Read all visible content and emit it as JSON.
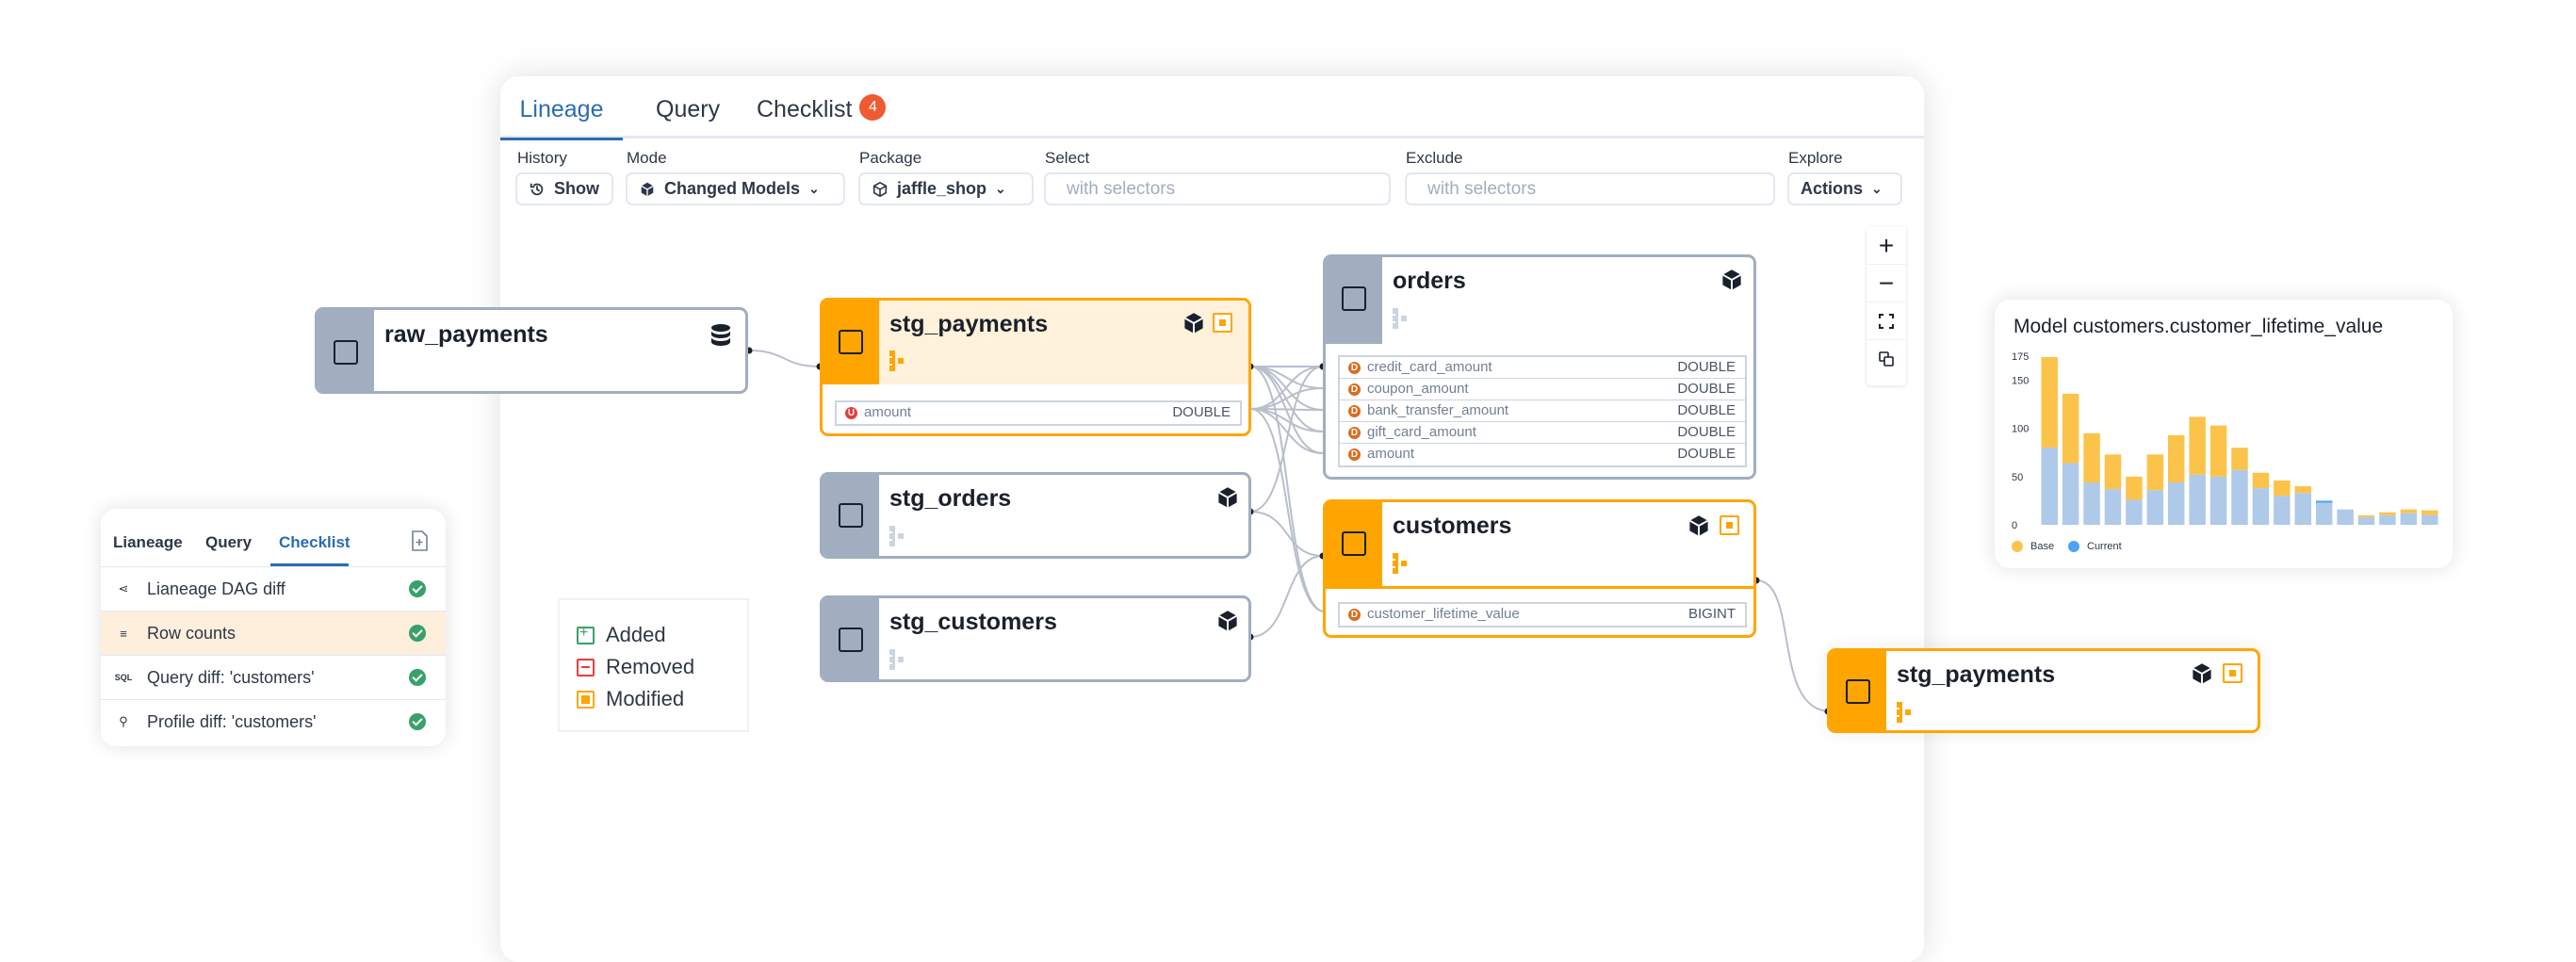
{
  "tabs": [
    {
      "label": "Lineage"
    },
    {
      "label": "Query"
    },
    {
      "label": "Checklist",
      "badge": "4"
    }
  ],
  "toolbar": {
    "history_label": "History",
    "history_button": "Show",
    "mode_label": "Mode",
    "mode_value": "Changed Models",
    "package_label": "Package",
    "package_value": "jaffle_shop",
    "select_label": "Select",
    "select_placeholder": "with selectors",
    "exclude_label": "Exclude",
    "exclude_placeholder": "with selectors",
    "explore_label": "Explore",
    "explore_button": "Actions"
  },
  "nodes": {
    "raw_payments": {
      "name": "raw_payments",
      "kind": "source",
      "icon": "database-icon"
    },
    "stg_payments": {
      "name": "stg_payments",
      "kind": "model",
      "status": "modified",
      "columns": [
        {
          "badge": "U",
          "name": "amount",
          "type": "DOUBLE"
        }
      ]
    },
    "stg_orders": {
      "name": "stg_orders",
      "kind": "model"
    },
    "stg_customers": {
      "name": "stg_customers",
      "kind": "model"
    },
    "orders": {
      "name": "orders",
      "kind": "model",
      "columns": [
        {
          "badge": "D",
          "name": "credit_card_amount",
          "type": "DOUBLE"
        },
        {
          "badge": "D",
          "name": "coupon_amount",
          "type": "DOUBLE"
        },
        {
          "badge": "D",
          "name": "bank_transfer_amount",
          "type": "DOUBLE"
        },
        {
          "badge": "D",
          "name": "gift_card_amount",
          "type": "DOUBLE"
        },
        {
          "badge": "D",
          "name": "amount",
          "type": "DOUBLE"
        }
      ]
    },
    "customers": {
      "name": "customers",
      "kind": "model",
      "status": "modified",
      "columns": [
        {
          "badge": "D",
          "name": "customer_lifetime_value",
          "type": "BIGINT"
        }
      ]
    },
    "stg_payments_focus": {
      "name": "stg_payments",
      "kind": "model",
      "status": "modified"
    }
  },
  "legend": [
    {
      "label": "Added",
      "color": "#38a169"
    },
    {
      "label": "Removed",
      "color": "#e53e3e"
    },
    {
      "label": "Modified",
      "color": "#ffa502"
    }
  ],
  "checklist": {
    "tabs": [
      {
        "label": "Lianeage"
      },
      {
        "label": "Query"
      },
      {
        "label": "Checklist"
      }
    ],
    "items": [
      {
        "label": "Lianeage DAG diff",
        "icon": "lineage-icon"
      },
      {
        "label": "Row counts",
        "icon": "row-count-icon",
        "selected": true
      },
      {
        "label": "Query diff: 'customers'",
        "icon": "sql-icon",
        "icon_text": "SQL"
      },
      {
        "label": "Profile diff: 'customers'",
        "icon": "profile-icon"
      }
    ]
  },
  "histogram": {
    "title": "Model customers.customer_lifetime_value",
    "legend": [
      {
        "label": "Base",
        "color": "#fcc34b"
      },
      {
        "label": "Current",
        "color": "#4aa4f3"
      }
    ]
  },
  "chart_data": {
    "type": "bar",
    "title": "Model customers.customer_lifetime_value",
    "ylim": [
      0,
      175
    ],
    "yticks": [
      0,
      50,
      100,
      150,
      175
    ],
    "series": [
      {
        "name": "Base",
        "values": [
          174,
          136,
          95,
          73,
          50,
          73,
          93,
          112,
          103,
          80,
          54,
          46,
          40,
          23,
          16,
          10,
          13,
          16,
          15
        ]
      },
      {
        "name": "Current",
        "values": [
          80,
          64,
          44,
          37,
          26,
          36,
          44,
          52,
          50,
          57,
          38,
          30,
          33,
          25,
          16,
          8,
          10,
          12,
          10
        ]
      }
    ],
    "colors": {
      "base": "#fcc34b",
      "current": "#4aa4f3",
      "overlap": "#afc9e8"
    }
  }
}
